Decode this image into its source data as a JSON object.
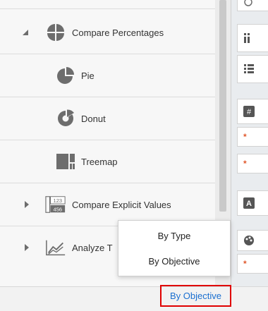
{
  "list": {
    "compare_percentages": {
      "label": "Compare Percentages",
      "icon": "pie-quadrant-icon",
      "expanded": true
    },
    "children": [
      {
        "label": "Pie",
        "icon": "pie-chart-icon"
      },
      {
        "label": "Donut",
        "icon": "donut-chart-icon"
      },
      {
        "label": "Treemap",
        "icon": "treemap-icon"
      }
    ],
    "compare_explicit": {
      "label": "Compare Explicit Values",
      "icon": "number-tiles-icon",
      "icon_text_top": "123",
      "icon_text_bottom": "456"
    },
    "analyze": {
      "label": "Analyze T",
      "icon": "trend-line-icon"
    }
  },
  "popup": {
    "items": [
      "By Type",
      "By Objective"
    ]
  },
  "footer": {
    "link_label": "By Objective"
  },
  "colors": {
    "icon_gray": "#6d6d6d",
    "link_blue": "#1a6fd0",
    "highlight_red": "#e00000",
    "required_orange": "#e0572b"
  },
  "right_strip": {
    "required_marker": "*"
  }
}
